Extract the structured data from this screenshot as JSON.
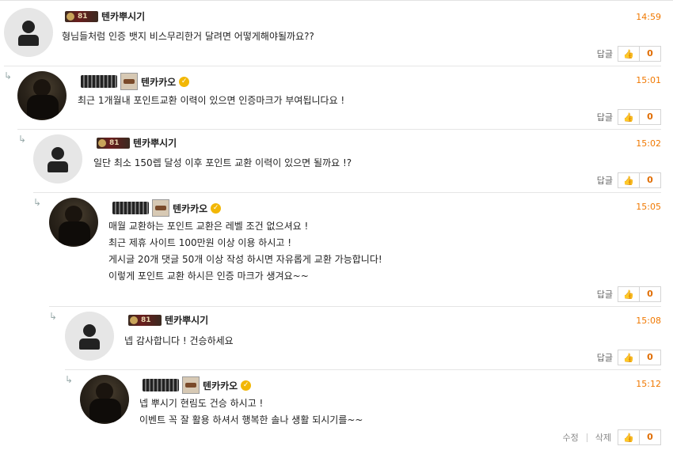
{
  "comments": [
    {
      "nick": "텐카뿌시기",
      "level_badge": "81",
      "time": "14:59",
      "lines": [
        "형님들처럼 인증 뱃지 비스무리한거 달려면 어떻게해야될까요??"
      ],
      "reply_label": "답글",
      "likes": "0"
    },
    {
      "nick": "텐카카오",
      "time": "15:01",
      "lines": [
        "최근 1개월내 포인트교환 이력이 있으면 인증마크가 부여됩니다요 !"
      ],
      "reply_label": "답글",
      "likes": "0"
    },
    {
      "nick": "텐카뿌시기",
      "level_badge": "81",
      "time": "15:02",
      "lines": [
        "일단 최소 150렙 달성 이후 포인트 교환 이력이 있으면 될까요 !?"
      ],
      "reply_label": "답글",
      "likes": "0"
    },
    {
      "nick": "텐카카오",
      "time": "15:05",
      "lines": [
        "매월 교환하는 포인트 교환은 레벨 조건 없으셔요 !",
        "최근 제휴 사이트 100만원 이상 이용 하시고 !",
        "게시글 20개 댓글 50개 이상 작성 하시면 자유롭게 교환 가능합니다!",
        "이렇게 포인트 교환 하시믄 인증 마크가 생겨요~~"
      ],
      "reply_label": "답글",
      "likes": "0"
    },
    {
      "nick": "텐카뿌시기",
      "level_badge": "81",
      "time": "15:08",
      "lines": [
        "넵 감사합니다 ! 건승하세요"
      ],
      "reply_label": "답글",
      "likes": "0"
    },
    {
      "nick": "텐카카오",
      "time": "15:12",
      "lines": [
        "넵 뿌시기 현림도 건승 하시고 !",
        "이벤트 꼭 잘 활용 하셔서 행복한 솔나 생활 되시기를~~"
      ],
      "edit_label": "수정",
      "delete_label": "삭제",
      "likes": "0"
    }
  ],
  "icons": {
    "reply_arrow": "reply-arrow-icon",
    "default_avatar": "user-silhouette-icon",
    "thumb": "thumbs-up-icon",
    "verified": "verified-check-icon"
  },
  "colors": {
    "time": "#f07800",
    "like_count": "#e06c00",
    "verified": "#f2b705"
  }
}
